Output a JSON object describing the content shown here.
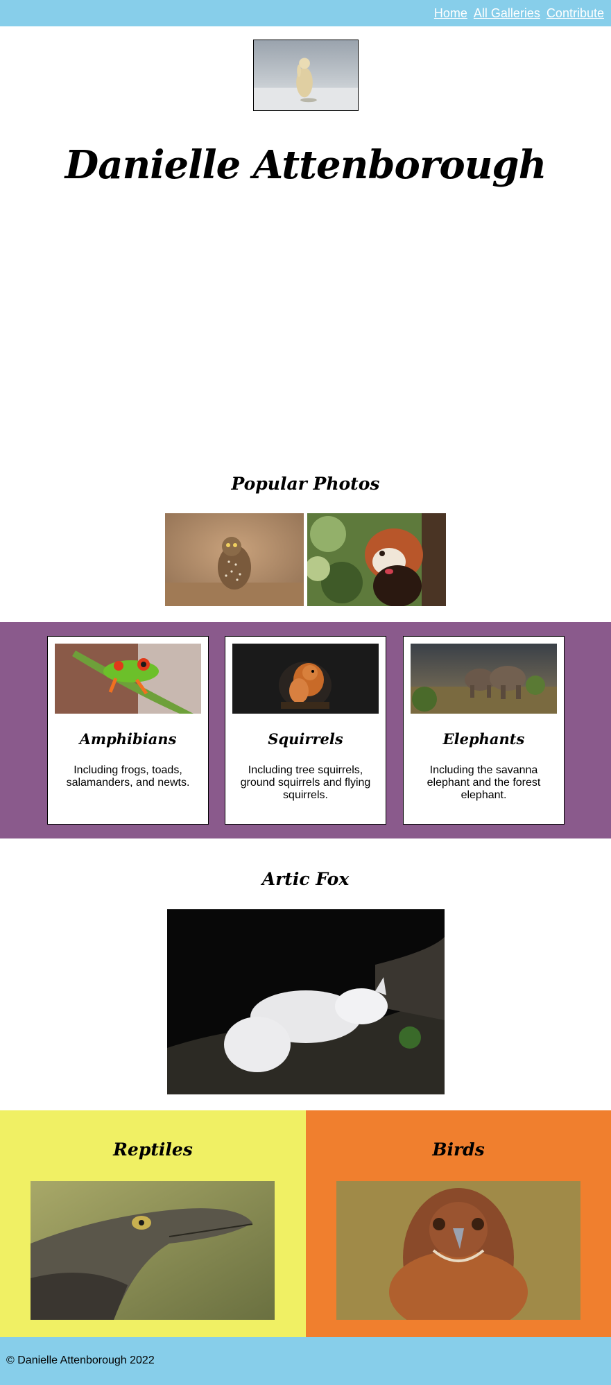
{
  "nav": {
    "home": "Home",
    "all_galleries": "All Galleries",
    "contribute": "Contribute"
  },
  "site": {
    "title": "Danielle Attenborough"
  },
  "popular": {
    "heading": "Popular Photos"
  },
  "categories": [
    {
      "title": "Amphibians",
      "description": "Including frogs, toads, salamanders, and newts."
    },
    {
      "title": "Squirrels",
      "description": "Including tree squirrels, ground squirrels and flying squirrels."
    },
    {
      "title": "Elephants",
      "description": "Including the savanna elephant and the forest elephant."
    }
  ],
  "feature": {
    "heading": "Artic Fox"
  },
  "reptiles": {
    "heading": "Reptiles"
  },
  "birds": {
    "heading": "Birds"
  },
  "footer": {
    "text": "© Danielle Attenborough 2022"
  },
  "colors": {
    "topbar": "#87ceea",
    "purple": "#8a5a8c",
    "yellow": "#f0f064",
    "orange": "#f07f2e"
  }
}
